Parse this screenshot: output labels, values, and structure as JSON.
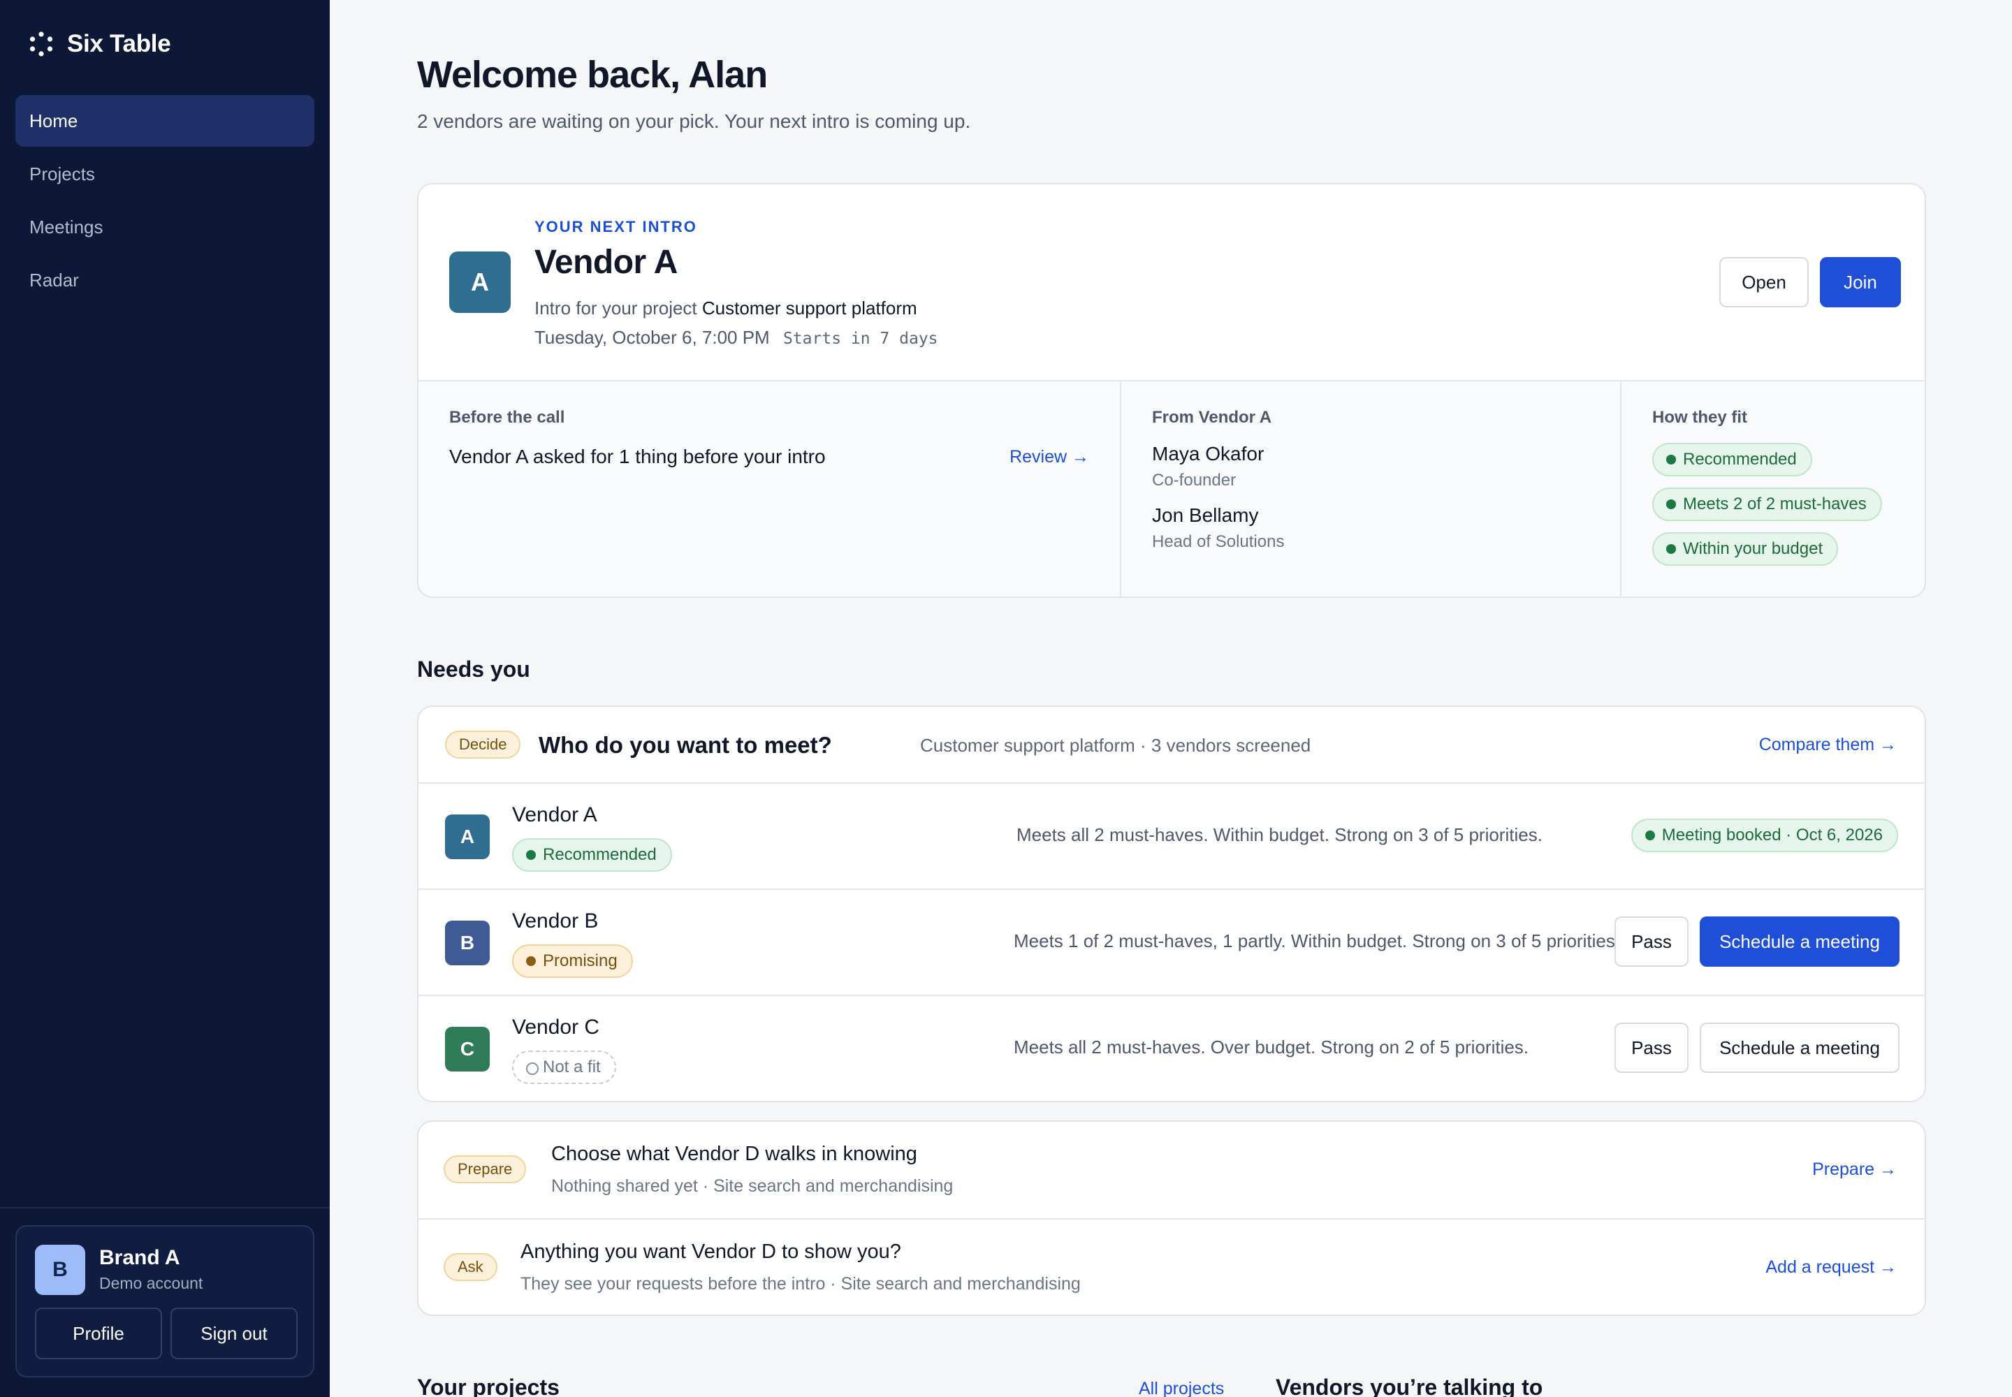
{
  "app": {
    "name": "Six Table"
  },
  "sidebar": {
    "items": [
      {
        "label": "Home",
        "active": true
      },
      {
        "label": "Projects"
      },
      {
        "label": "Meetings"
      },
      {
        "label": "Radar"
      }
    ],
    "account": {
      "initial": "B",
      "name": "Brand A",
      "subtitle": "Demo account",
      "profile_label": "Profile",
      "signout_label": "Sign out"
    }
  },
  "header": {
    "title": "Welcome back, Alan",
    "subtitle": "2 vendors are waiting on your pick. Your next intro is coming up."
  },
  "next_intro": {
    "eyebrow": "YOUR NEXT INTRO",
    "initial": "A",
    "vendor": "Vendor A",
    "project_prefix": "Intro for your project",
    "project_name": "Customer support platform",
    "datetime": "Tuesday, October 6, 7:00 PM",
    "starts_in": "Starts in 7 days",
    "open_label": "Open",
    "join_label": "Join",
    "before_call": {
      "heading": "Before the call",
      "text": "Vendor A asked for 1 thing before your intro",
      "link": "Review →"
    },
    "from_vendor": {
      "heading": "From Vendor A",
      "people": [
        {
          "name": "Maya Okafor",
          "role": "Co-founder"
        },
        {
          "name": "Jon Bellamy",
          "role": "Head of Solutions"
        }
      ]
    },
    "fit": {
      "heading": "How they fit",
      "chips": [
        "Recommended",
        "Meets 2 of 2 must-haves",
        "Within your budget"
      ]
    }
  },
  "needs_you": {
    "title": "Needs you",
    "decide": {
      "tag": "Decide",
      "question": "Who do you want to meet?",
      "meta": "Customer support platform · 3 vendors screened",
      "link": "Compare them →",
      "vendors": [
        {
          "initial": "A",
          "name": "Vendor A",
          "status": "Recommended",
          "desc": "Meets all 2 must-haves. Within budget. Strong on 3 of 5 priorities.",
          "booked": "Meeting booked · Oct 6, 2026",
          "color": "#2f6e91"
        },
        {
          "initial": "B",
          "name": "Vendor B",
          "status": "Promising",
          "desc": "Meets 1 of 2 must-haves, 1 partly. Within budget. Strong on 3 of 5 priorities.",
          "pass_label": "Pass",
          "schedule_label": "Schedule a meeting",
          "color": "#3f5a94"
        },
        {
          "initial": "C",
          "name": "Vendor C",
          "status": "Not a fit",
          "desc": "Meets all 2 must-haves. Over budget. Strong on 2 of 5 priorities.",
          "pass_label": "Pass",
          "schedule_label": "Schedule a meeting",
          "color": "#2f7a57"
        }
      ]
    },
    "prepare": {
      "tag": "Prepare",
      "title": "Choose what Vendor D walks in knowing",
      "subtitle": "Nothing shared yet · Site search and merchandising",
      "link": "Prepare →"
    },
    "ask": {
      "tag": "Ask",
      "title": "Anything you want Vendor D to show you?",
      "subtitle": "They see your requests before the intro · Site search and merchandising",
      "link": "Add a request →"
    }
  },
  "footer_sections": {
    "projects_title": "Your projects",
    "projects_link": "All projects",
    "vendors_title": "Vendors you’re talking to"
  }
}
